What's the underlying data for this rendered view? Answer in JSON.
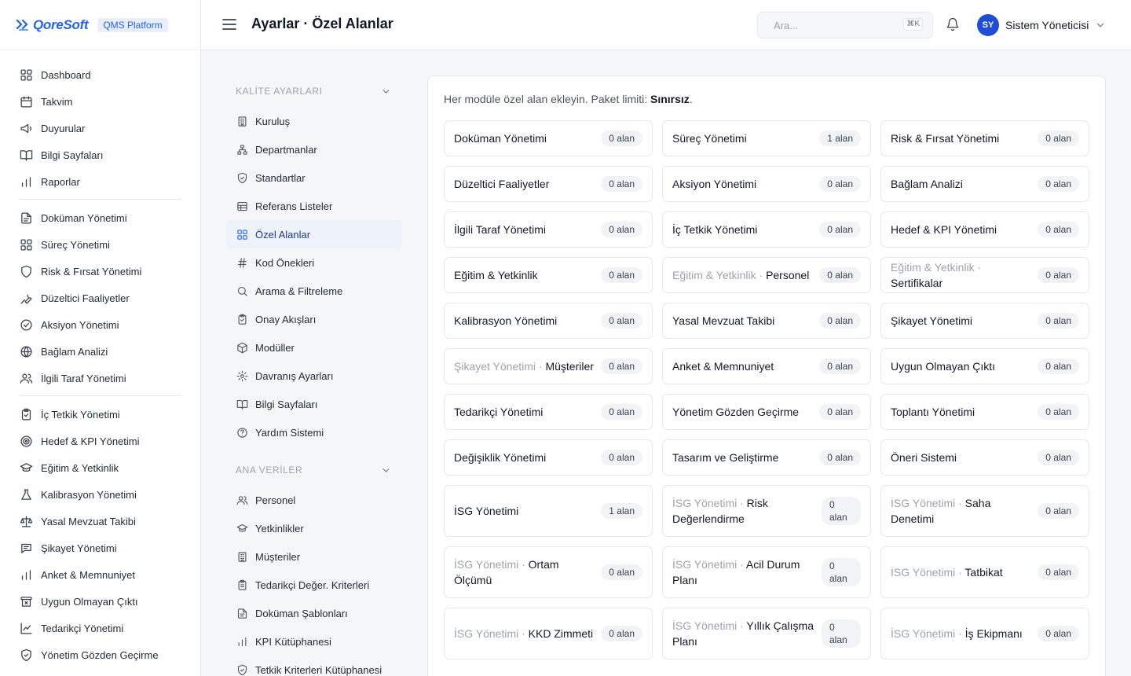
{
  "brand": {
    "name": "QoreSoft",
    "badge": "QMS Platform"
  },
  "nav": {
    "items": [
      {
        "label": "Dashboard",
        "icon": "grid-icon"
      },
      {
        "label": "Takvim",
        "icon": "calendar-icon"
      },
      {
        "label": "Duyurular",
        "icon": "megaphone-icon"
      },
      {
        "label": "Bilgi Sayfaları",
        "icon": "book-icon"
      },
      {
        "label": "Raporlar",
        "icon": "bar-chart-icon"
      },
      {
        "sep": true
      },
      {
        "label": "Doküman Yönetimi",
        "icon": "document-icon"
      },
      {
        "label": "Süreç Yönetimi",
        "icon": "grid-icon"
      },
      {
        "label": "Risk & Fırsat Yönetimi",
        "icon": "shield-icon"
      },
      {
        "label": "Düzeltici Faaliyetler",
        "icon": "wrench-icon"
      },
      {
        "label": "Aksiyon Yönetimi",
        "icon": "check-circle-icon"
      },
      {
        "label": "Bağlam Analizi",
        "icon": "globe-icon"
      },
      {
        "label": "İlgili Taraf Yönetimi",
        "icon": "users-icon"
      },
      {
        "sep": true
      },
      {
        "label": "İç Tetkik Yönetimi",
        "icon": "clipboard-check-icon"
      },
      {
        "label": "Hedef & KPI Yönetimi",
        "icon": "target-icon"
      },
      {
        "label": "Eğitim & Yetkinlik",
        "icon": "graduation-cap-icon"
      },
      {
        "label": "Kalibrasyon Yönetimi",
        "icon": "flask-icon"
      },
      {
        "label": "Yasal Mevzuat Takibi",
        "icon": "scale-icon"
      },
      {
        "label": "Şikayet Yönetimi",
        "icon": "message-icon"
      },
      {
        "label": "Anket & Memnuniyet",
        "icon": "bar-chart-icon"
      },
      {
        "label": "Uygun Olmayan Çıktı",
        "icon": "archive-x-icon"
      },
      {
        "label": "Tedarikçi Yönetimi",
        "icon": "line-chart-icon"
      },
      {
        "label": "Yönetim Gözden Geçirme",
        "icon": "shield-check-icon"
      }
    ]
  },
  "topbar": {
    "title": "Ayarlar · Özel Alanlar",
    "search_placeholder": "Ara...",
    "search_shortcut": "⌘K",
    "user_initials": "SY",
    "user_name": "Sistem Yöneticisi"
  },
  "settings": {
    "groups": [
      {
        "title": "KALİTE AYARLARI",
        "items": [
          {
            "label": "Kuruluş",
            "icon": "building-icon"
          },
          {
            "label": "Departmanlar",
            "icon": "hierarchy-icon"
          },
          {
            "label": "Standartlar",
            "icon": "shield-check-icon"
          },
          {
            "label": "Referans Listeler",
            "icon": "table-icon"
          },
          {
            "label": "Özel Alanlar",
            "icon": "grid-icon",
            "active": true
          },
          {
            "label": "Kod Önekleri",
            "icon": "hash-icon"
          },
          {
            "label": "Arama & Filtreleme",
            "icon": "search-icon"
          },
          {
            "label": "Onay Akışları",
            "icon": "clipboard-check-icon"
          },
          {
            "label": "Modüller",
            "icon": "cube-icon"
          },
          {
            "label": "Davranış Ayarları",
            "icon": "gear-icon"
          },
          {
            "label": "Bilgi Sayfaları",
            "icon": "book-icon"
          },
          {
            "label": "Yardım Sistemi",
            "icon": "help-circle-icon"
          }
        ]
      },
      {
        "title": "ANA VERİLER",
        "items": [
          {
            "label": "Personel",
            "icon": "users-icon"
          },
          {
            "label": "Yetkinlikler",
            "icon": "graduation-cap-icon"
          },
          {
            "label": "Müşteriler",
            "icon": "building-icon"
          },
          {
            "label": "Tedarikçi Değer. Kriterleri",
            "icon": "clipboard-list-icon"
          },
          {
            "label": "Doküman Şablonları",
            "icon": "document-icon"
          },
          {
            "label": "KPI Kütüphanesi",
            "icon": "bar-chart-icon"
          },
          {
            "label": "Tetkik Kriterleri Kütüphanesi",
            "icon": "shield-check-icon"
          }
        ]
      }
    ]
  },
  "main": {
    "intro_prefix": "Her modüle özel alan ekleyin. Paket limiti: ",
    "intro_limit": "Sınırsız",
    "intro_suffix": ".",
    "cards": [
      {
        "prefix": "",
        "name": "Doküman Yönetimi",
        "count": "0 alan"
      },
      {
        "prefix": "",
        "name": "Süreç Yönetimi",
        "count": "1 alan"
      },
      {
        "prefix": "",
        "name": "Risk & Fırsat Yönetimi",
        "count": "0 alan"
      },
      {
        "prefix": "",
        "name": "Düzeltici Faaliyetler",
        "count": "0 alan"
      },
      {
        "prefix": "",
        "name": "Aksiyon Yönetimi",
        "count": "0 alan"
      },
      {
        "prefix": "",
        "name": "Bağlam Analizi",
        "count": "0 alan"
      },
      {
        "prefix": "",
        "name": "İlgili Taraf Yönetimi",
        "count": "0 alan"
      },
      {
        "prefix": "",
        "name": "İç Tetkik Yönetimi",
        "count": "0 alan"
      },
      {
        "prefix": "",
        "name": "Hedef & KPI Yönetimi",
        "count": "0 alan"
      },
      {
        "prefix": "",
        "name": "Eğitim & Yetkinlik",
        "count": "0 alan"
      },
      {
        "prefix": "Eğitim & Yetkinlik · ",
        "name": "Personel",
        "count": "0 alan"
      },
      {
        "prefix": "Eğitim & Yetkinlik · ",
        "name": "Sertifikalar",
        "count": "0 alan"
      },
      {
        "prefix": "",
        "name": "Kalibrasyon Yönetimi",
        "count": "0 alan"
      },
      {
        "prefix": "",
        "name": "Yasal Mevzuat Takibi",
        "count": "0 alan"
      },
      {
        "prefix": "",
        "name": "Şikayet Yönetimi",
        "count": "0 alan"
      },
      {
        "prefix": "Şikayet Yönetimi · ",
        "name": "Müşteriler",
        "count": "0 alan"
      },
      {
        "prefix": "",
        "name": "Anket & Memnuniyet",
        "count": "0 alan"
      },
      {
        "prefix": "",
        "name": "Uygun Olmayan Çıktı",
        "count": "0 alan"
      },
      {
        "prefix": "",
        "name": "Tedarikçi Yönetimi",
        "count": "0 alan"
      },
      {
        "prefix": "",
        "name": "Yönetim Gözden Geçirme",
        "count": "0 alan"
      },
      {
        "prefix": "",
        "name": "Toplantı Yönetimi",
        "count": "0 alan"
      },
      {
        "prefix": "",
        "name": "Değişiklik Yönetimi",
        "count": "0 alan"
      },
      {
        "prefix": "",
        "name": "Tasarım ve Geliştirme",
        "count": "0 alan"
      },
      {
        "prefix": "",
        "name": "Öneri Sistemi",
        "count": "0 alan"
      },
      {
        "prefix": "",
        "name": "İSG Yönetimi",
        "count": "1 alan"
      },
      {
        "prefix": "İSG Yönetimi · ",
        "name": "Risk Değerlendirme",
        "count": "0 alan",
        "wrap": true
      },
      {
        "prefix": "İSG Yönetimi · ",
        "name": "Saha Denetimi",
        "count": "0 alan"
      },
      {
        "prefix": "İSG Yönetimi · ",
        "name": "Ortam Ölçümü",
        "count": "0 alan"
      },
      {
        "prefix": "İSG Yönetimi · ",
        "name": "Acil Durum Planı",
        "count": "0 alan",
        "wrap": true
      },
      {
        "prefix": "İSG Yönetimi · ",
        "name": "Tatbikat",
        "count": "0 alan"
      },
      {
        "prefix": "İSG Yönetimi · ",
        "name": "KKD Zimmeti",
        "count": "0 alan"
      },
      {
        "prefix": "İSG Yönetimi · ",
        "name": "Yıllık Çalışma Planı",
        "count": "0 alan",
        "wrap": true
      },
      {
        "prefix": "İSG Yönetimi · ",
        "name": "İş Ekipmanı",
        "count": "0 alan"
      }
    ]
  },
  "colors": {
    "accent": "#2563eb",
    "active_bg": "#eef2fb",
    "border": "#e6e8ec",
    "badge_bg": "#f1f3f6"
  }
}
